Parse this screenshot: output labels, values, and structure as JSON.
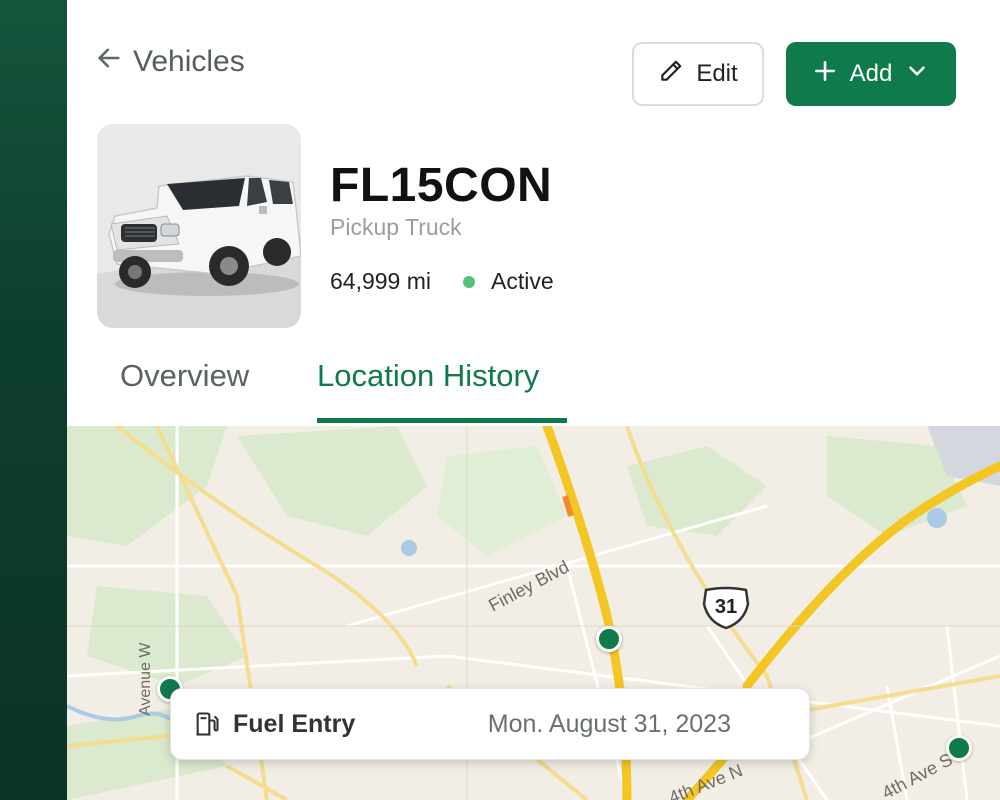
{
  "header": {
    "back_label": "Vehicles",
    "edit_label": "Edit",
    "add_label": "Add"
  },
  "vehicle": {
    "name": "FL15CON",
    "type": "Pickup Truck",
    "mileage": "64,999 mi",
    "status": "Active",
    "status_color": "#55c27a"
  },
  "tabs": [
    {
      "label": "Overview",
      "active": false
    },
    {
      "label": "Location History",
      "active": true
    }
  ],
  "map": {
    "street_labels": [
      "Finley Blvd",
      "Avenue W",
      "4th Ave N",
      "4th Ave S"
    ],
    "route_shield": "31",
    "card": {
      "icon": "fuel-pump-icon",
      "title": "Fuel Entry",
      "date": "Mon. August 31, 2023"
    }
  },
  "colors": {
    "brand": "#0f7a4b",
    "rail": "#0e3f2d"
  }
}
